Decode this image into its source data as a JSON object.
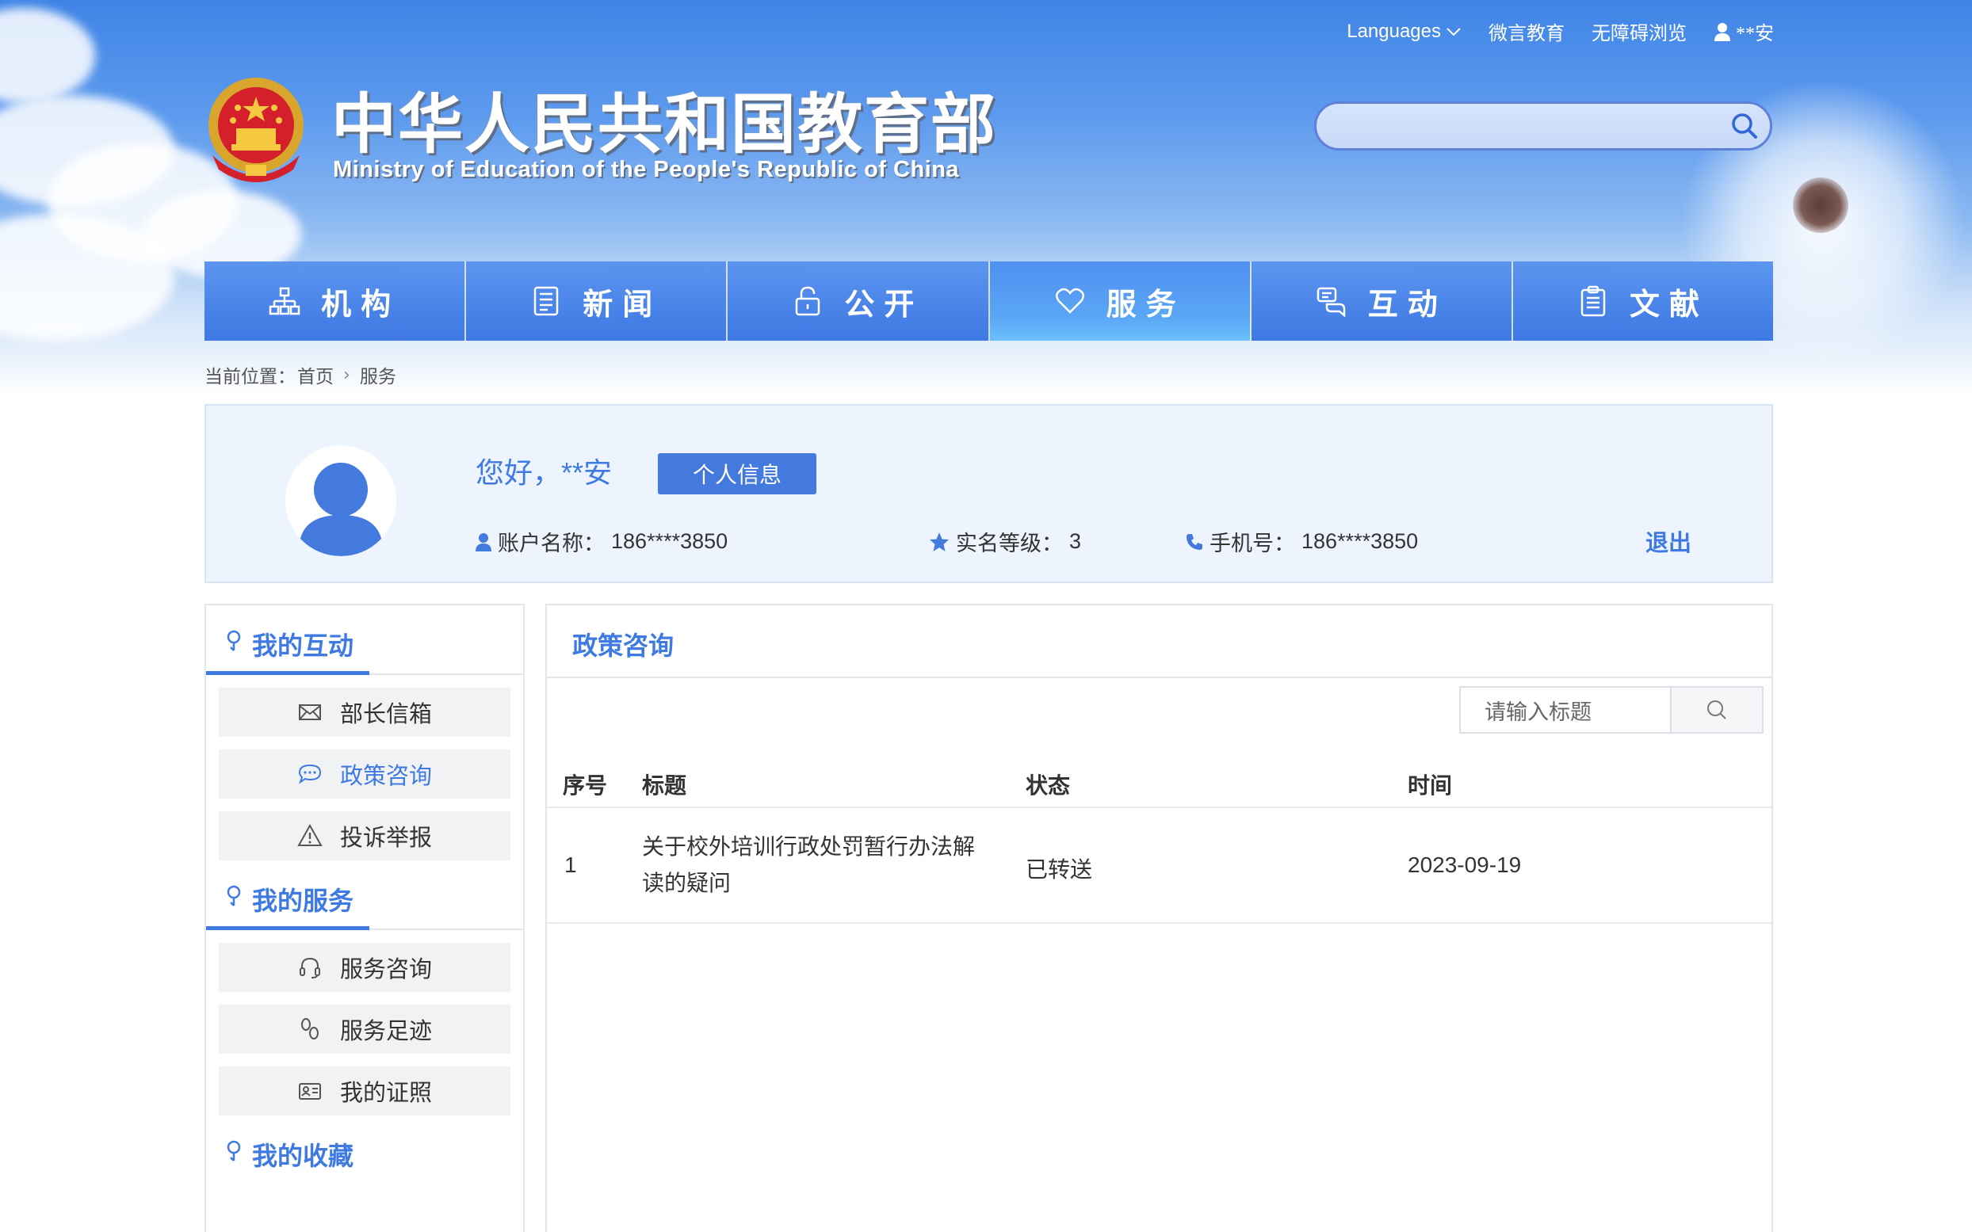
{
  "top_links": {
    "languages": "Languages",
    "weiyan": "微言教育",
    "accessible": "无障碍浏览",
    "user": "**安"
  },
  "site": {
    "title": "中华人民共和国教育部",
    "subtitle": "Ministry of Education of the People's Republic of China"
  },
  "nav": {
    "items": [
      {
        "label": "机构",
        "icon": "org-chart-icon"
      },
      {
        "label": "新闻",
        "icon": "news-icon"
      },
      {
        "label": "公开",
        "icon": "unlock-icon"
      },
      {
        "label": "服务",
        "icon": "heart-icon",
        "active": true
      },
      {
        "label": "互动",
        "icon": "chat-icon"
      },
      {
        "label": "文献",
        "icon": "document-icon"
      }
    ]
  },
  "breadcrumb": {
    "prefix": "当前位置：",
    "home": "首页",
    "current": "服务"
  },
  "user_panel": {
    "greeting": "您好，**安",
    "info_button": "个人信息",
    "account_label": "账户名称：",
    "account_value": "186****3850",
    "level_label": "实名等级：",
    "level_value": "3",
    "phone_label": "手机号：",
    "phone_value": "186****3850",
    "logout": "退出"
  },
  "sidebar": {
    "sections": [
      {
        "title": "我的互动",
        "items": [
          {
            "label": "部长信箱",
            "icon": "mail-icon"
          },
          {
            "label": "政策咨询",
            "icon": "speech-bubble-icon",
            "active": true
          },
          {
            "label": "投诉举报",
            "icon": "warning-icon"
          }
        ]
      },
      {
        "title": "我的服务",
        "items": [
          {
            "label": "服务咨询",
            "icon": "headset-icon"
          },
          {
            "label": "服务足迹",
            "icon": "footprint-icon"
          },
          {
            "label": "我的证照",
            "icon": "id-card-icon"
          }
        ]
      },
      {
        "title": "我的收藏",
        "items": []
      }
    ]
  },
  "main": {
    "title": "政策咨询",
    "search_placeholder": "请输入标题",
    "columns": [
      "序号",
      "标题",
      "状态",
      "时间"
    ],
    "rows": [
      {
        "index": "1",
        "title": "关于校外培训行政处罚暂行办法解读的疑问",
        "status": "已转送",
        "time": "2023-09-19"
      }
    ]
  },
  "colors": {
    "accent": "#3e7ae2",
    "nav": "#4a83e8",
    "panel_bg": "#edf4fd"
  }
}
